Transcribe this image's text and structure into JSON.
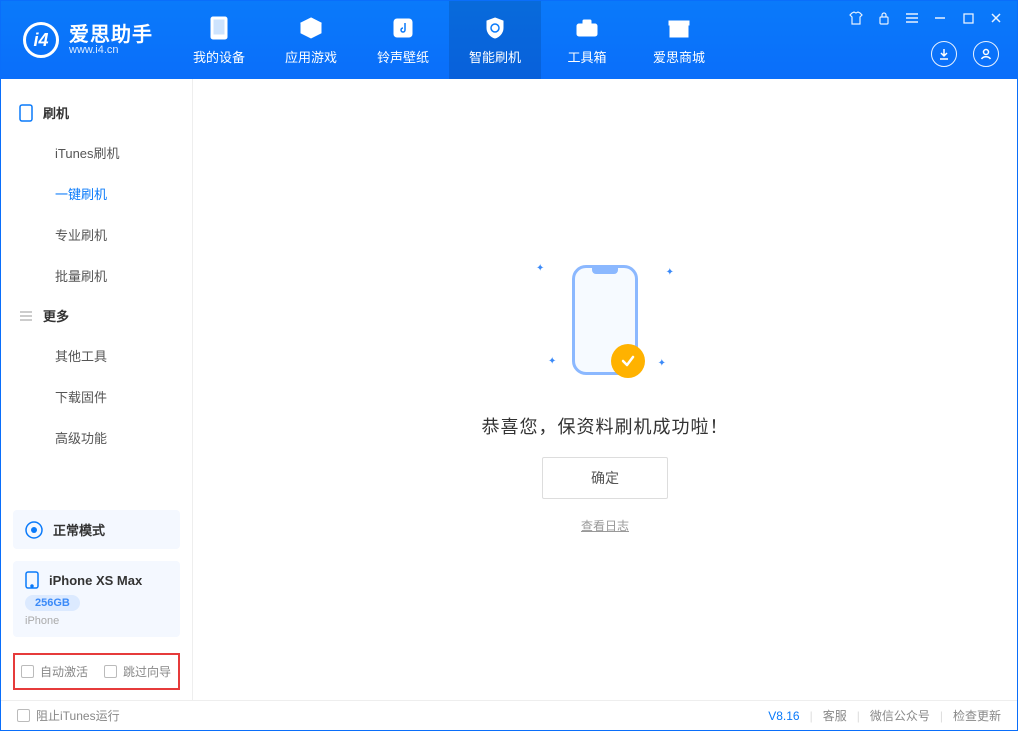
{
  "logo": {
    "title": "爱思助手",
    "sub": "www.i4.cn"
  },
  "nav": [
    {
      "label": "我的设备"
    },
    {
      "label": "应用游戏"
    },
    {
      "label": "铃声壁纸"
    },
    {
      "label": "智能刷机"
    },
    {
      "label": "工具箱"
    },
    {
      "label": "爱思商城"
    }
  ],
  "sidebar": {
    "group1": "刷机",
    "items1": [
      {
        "label": "iTunes刷机"
      },
      {
        "label": "一键刷机"
      },
      {
        "label": "专业刷机"
      },
      {
        "label": "批量刷机"
      }
    ],
    "group2": "更多",
    "items2": [
      {
        "label": "其他工具"
      },
      {
        "label": "下载固件"
      },
      {
        "label": "高级功能"
      }
    ],
    "mode": "正常模式",
    "device_name": "iPhone XS Max",
    "device_storage": "256GB",
    "device_type": "iPhone",
    "opt_auto_activate": "自动激活",
    "opt_skip_guide": "跳过向导"
  },
  "main": {
    "success_text": "恭喜您，保资料刷机成功啦！",
    "ok_label": "确定",
    "log_link": "查看日志"
  },
  "footer": {
    "block_itunes": "阻止iTunes运行",
    "version": "V8.16",
    "links": [
      "客服",
      "微信公众号",
      "检查更新"
    ]
  }
}
